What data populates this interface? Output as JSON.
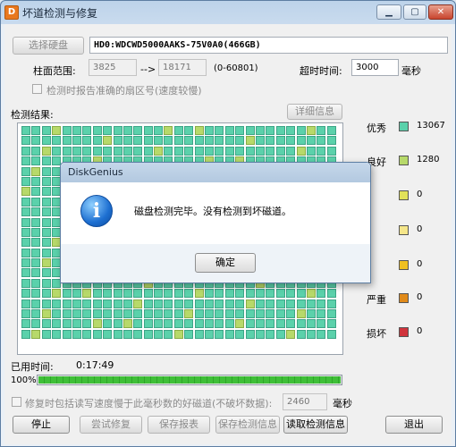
{
  "window": {
    "title": "坏道检测与修复"
  },
  "toolbar": {
    "select_disk_label": "选择硬盘",
    "disk_info": "HD0:WDCWD5000AAKS-75V0A0(466GB)"
  },
  "range": {
    "label": "柱面范围:",
    "start": "3825",
    "arrow": "-->",
    "end": "18171",
    "total": "(0-60801)"
  },
  "timeout": {
    "label": "超时时间:",
    "value": "3000",
    "unit": "毫秒"
  },
  "option_report": {
    "label": "检测时报告准确的扇区号(速度较慢)",
    "checked": false
  },
  "results": {
    "label": "检测结果:",
    "details_button": "详细信息"
  },
  "legend": [
    {
      "name": "优秀",
      "count": "13067",
      "color": "#5bd1ab"
    },
    {
      "name": "良好",
      "count": "1280",
      "color": "#b7d96a"
    },
    {
      "name": "",
      "count": "0",
      "color": "#e2e25a"
    },
    {
      "name": "",
      "count": "0",
      "color": "#f5e68a"
    },
    {
      "name": "",
      "count": "0",
      "color": "#f0c020"
    },
    {
      "name": "严重",
      "count": "0",
      "color": "#e08a1a"
    },
    {
      "name": "损坏",
      "count": "0",
      "color": "#d0343c"
    }
  ],
  "elapsed": {
    "label": "已用时间:",
    "value": "0:17:49"
  },
  "progress": {
    "percent_label": "100%",
    "value": 1.0
  },
  "repair_option": {
    "label": "修复时包括读写速度慢于此毫秒数的好磁道(不破坏数据):",
    "value": "2460",
    "unit": "毫秒",
    "checked": false
  },
  "buttons": {
    "stop": "停止",
    "try_repair": "尝试修复",
    "save_report": "保存报表",
    "save_info": "保存检测信息",
    "read_info": "读取检测信息",
    "exit": "退出"
  },
  "dialog": {
    "title": "DiskGenius",
    "message": "磁盘检测完毕。没有检测到坏磁道。",
    "ok": "确定"
  }
}
